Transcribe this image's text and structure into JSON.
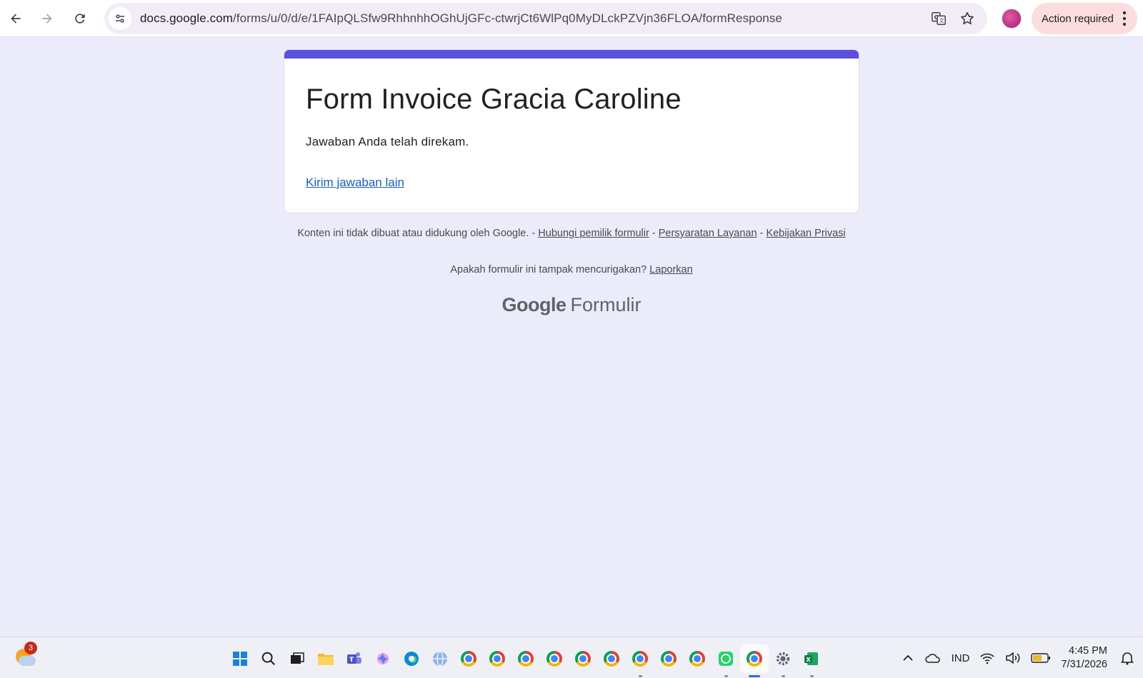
{
  "browser": {
    "url_host": "docs.google.com",
    "url_path": "/forms/u/0/d/e/1FAIpQLSfw9RhhnhhOGhUjGFc-ctwrjCt6WlPq0MyDLckPZVjn36FLOA/formResponse",
    "action_label": "Action required"
  },
  "form": {
    "title": "Form Invoice Gracia Caroline",
    "message": "Jawaban Anda telah direkam.",
    "another_link": "Kirim jawaban lain",
    "accent_color": "#5b4fe0"
  },
  "footer": {
    "disclaimer": "Konten ini tidak dibuat atau didukung oleh Google.",
    "sep": " - ",
    "contact_owner": "Hubungi pemilik formulir",
    "terms": "Persyaratan Layanan",
    "privacy": "Kebijakan Privasi",
    "suspicious_q": "Apakah formulir ini tampak mencurigakan?",
    "report": "Laporkan",
    "brand_google": "Google",
    "brand_product": "Formulir"
  },
  "taskbar": {
    "weather_badge": "3",
    "language": "IND",
    "time": "4:45 PM",
    "date": "7/31/2026"
  }
}
